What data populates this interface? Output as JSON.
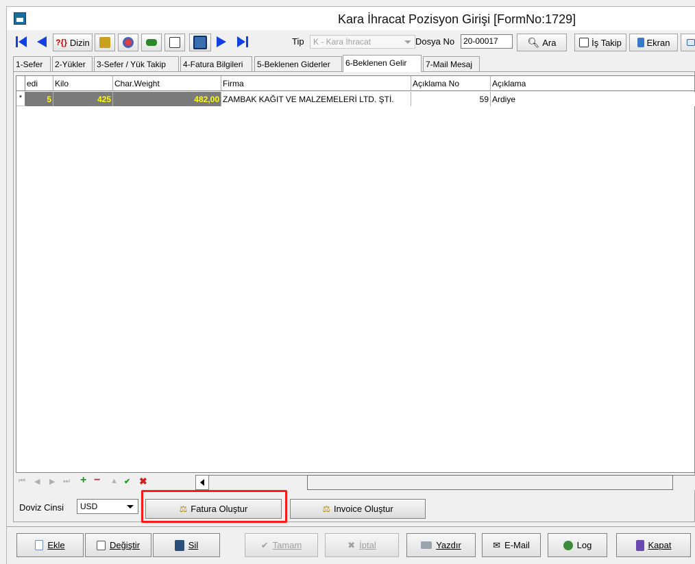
{
  "window": {
    "title": "Kara İhracat Pozisyon Girişi [FormNo:1729]"
  },
  "toolbar": {
    "dizin_label": "Dizin",
    "tip_label": "Tip",
    "tip_value": "K - Kara İhracat",
    "dosya_label": "Dosya No",
    "dosya_value": "20-00017",
    "ara_label": "Ara",
    "is_takip_label": "İş Takip",
    "ekran_label": "Ekran"
  },
  "tabs": [
    {
      "label": "1-Sefer"
    },
    {
      "label": "2-Yükler"
    },
    {
      "label": "3-Sefer / Yük Takip"
    },
    {
      "label": "4-Fatura Bilgileri"
    },
    {
      "label": "5-Beklenen Giderler"
    },
    {
      "label": "6-Beklenen Gelir"
    },
    {
      "label": "7-Mail Mesaj"
    }
  ],
  "grid": {
    "headers": [
      "edi",
      "Kilo",
      "Char.Weight",
      "Firma",
      "Açıklama No",
      "Açıklama"
    ],
    "rows": [
      {
        "indicator": "*",
        "edi": "5",
        "kilo": "425",
        "char_weight": "482,00",
        "firma": "ZAMBAK KAĞIT VE MALZEMELERİ LTD. ŞTİ.",
        "aciklama_no": "59",
        "aciklama": "Ardiye"
      }
    ]
  },
  "panel": {
    "doviz_label": "Doviz Cinsi",
    "doviz_value": "USD",
    "fatura_button": "Fatura Oluştur",
    "invoice_button": "Invoice Oluştur"
  },
  "footer": {
    "ekle": "Ekle",
    "degistir": "Değiştir",
    "sil": "Sil",
    "tamam": "Tamam",
    "iptal": "İptal",
    "yazdir": "Yazdır",
    "email": "E-Mail",
    "log": "Log",
    "kapat": "Kapat"
  },
  "colors": {
    "accent_nav": "#1340e0",
    "highlight": "#ff1a1a",
    "row_dark": "#7a7a7a",
    "row_text": "#ffff00"
  }
}
